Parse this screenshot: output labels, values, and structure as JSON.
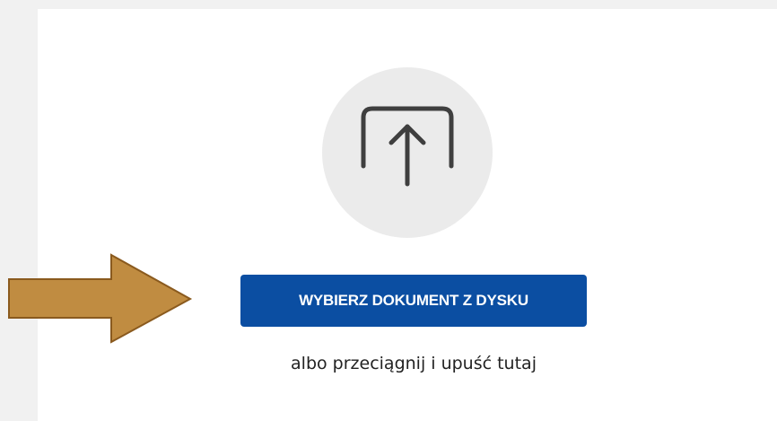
{
  "upload": {
    "icon": "upload-icon",
    "button_label": "WYBIERZ DOKUMENT Z DYSKU",
    "hint": "albo przeciągnij i upuść tutaj"
  },
  "annotation": {
    "icon": "right-arrow-pointer",
    "color": "#c08c41"
  },
  "colors": {
    "button_bg": "#0b4ea2",
    "circle_bg": "#ebebeb",
    "page_bg": "#f1f1f1"
  }
}
